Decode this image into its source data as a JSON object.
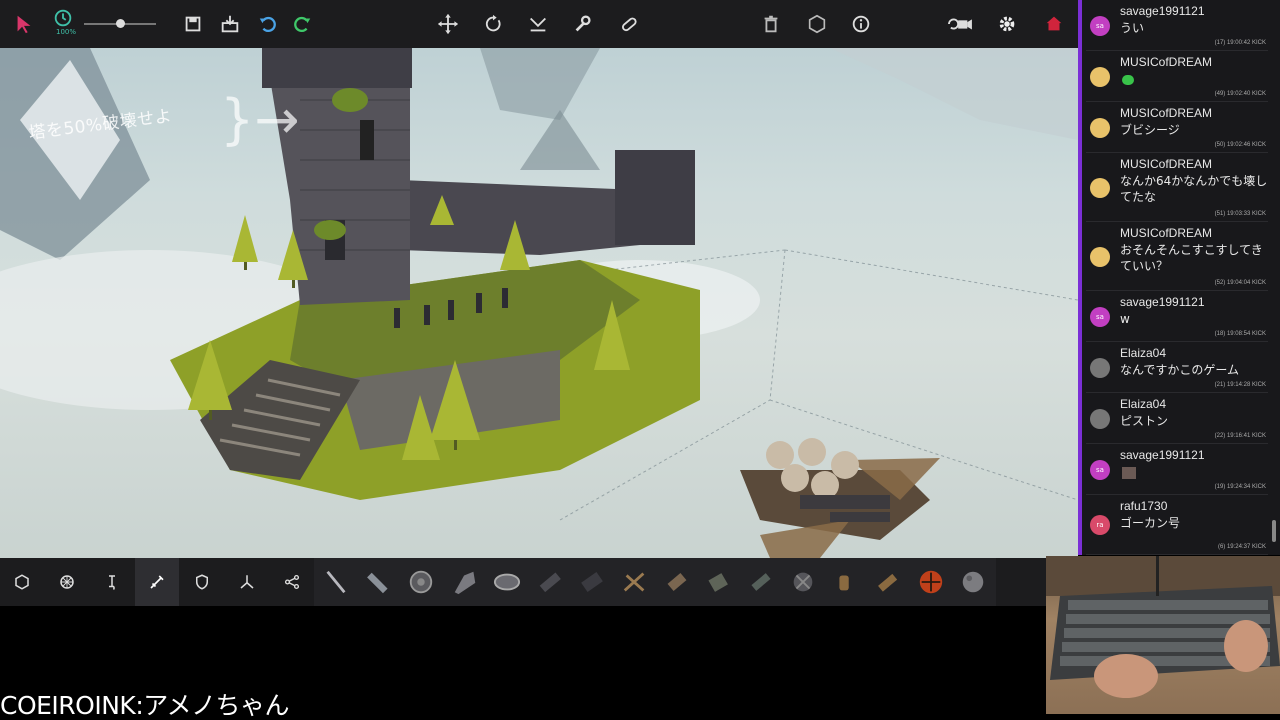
{
  "toolbar": {
    "zoom_label": "100%",
    "left_icons": [
      "cursor-select-icon",
      "clock-icon",
      "save-icon",
      "load-icon",
      "undo-icon",
      "redo-icon"
    ],
    "center_icons": [
      "move-icon",
      "rotate-icon",
      "mirror-icon",
      "wrench-icon",
      "pill-icon"
    ],
    "right_icons": [
      "trash-icon",
      "hexagon-icon",
      "info-icon",
      "camera-icon",
      "gear-icon",
      "home-icon"
    ],
    "accent": "#3fc0a8"
  },
  "viewport": {
    "objective_text": "塔を50%破壊せよ",
    "brace_text": "}→"
  },
  "blockbar": {
    "categories": [
      "basic-blocks-icon",
      "wheel-icon",
      "mechanical-icon",
      "weapons-icon",
      "armour-icon",
      "flight-icon",
      "automation-icon"
    ],
    "active_category": "weapons-icon",
    "blocks": [
      "sword-block",
      "spike-block",
      "grinder-block",
      "drill-block",
      "spinning-saw-block",
      "cannon-block",
      "shrapnel-cannon-block",
      "crossbow-block",
      "flamethrower-block",
      "vacuum-block",
      "water-cannon-block",
      "torch-block",
      "bomb-block",
      "grenade-block",
      "rocket-block",
      "fireball-block",
      "boulder-block"
    ]
  },
  "chat": {
    "messages": [
      {
        "user": "savage1991121",
        "text": "うい",
        "meta": "(17)  19:00:42  KICK",
        "avatar": "sa",
        "avatar_color": "#c23fc2"
      },
      {
        "user": "MUSICofDREAM",
        "text": "",
        "meta": "(49)  19:02:40  KICK",
        "avatar": "",
        "avatar_color": "#e8c26a",
        "emote": true
      },
      {
        "user": "MUSICofDREAM",
        "text": "ブビシージ",
        "meta": "(50)  19:02:46  KICK",
        "avatar": "",
        "avatar_color": "#e8c26a"
      },
      {
        "user": "MUSICofDREAM",
        "text": "なんか64かなんかでも壊してたな",
        "meta": "(51)  19:03:33  KICK",
        "avatar": "",
        "avatar_color": "#e8c26a"
      },
      {
        "user": "MUSICofDREAM",
        "text": "おそんそんこすこすしてきていい？",
        "meta": "(52)  19:04:04  KICK",
        "avatar": "",
        "avatar_color": "#e8c26a"
      },
      {
        "user": "savage1991121",
        "text": "w",
        "meta": "(18)  19:08:54  KICK",
        "avatar": "sa",
        "avatar_color": "#c23fc2"
      },
      {
        "user": "Elaiza04",
        "text": "なんですかこのゲーム",
        "meta": "(21)  19:14:28  KICK",
        "avatar": "",
        "avatar_color": "#777777"
      },
      {
        "user": "Elaiza04",
        "text": "ピストン",
        "meta": "(22)  19:16:41  KICK",
        "avatar": "",
        "avatar_color": "#777777"
      },
      {
        "user": "savage1991121",
        "text": "",
        "meta": "(19)  19:24:34  KICK",
        "avatar": "sa",
        "avatar_color": "#c23fc2",
        "image": true
      },
      {
        "user": "rafu1730",
        "text": "ゴーカン号",
        "meta": "(6)  19:24:37  KICK",
        "avatar": "ra",
        "avatar_color": "#d94a6a"
      }
    ]
  },
  "caption": "COEIROINK:アメノちゃん"
}
